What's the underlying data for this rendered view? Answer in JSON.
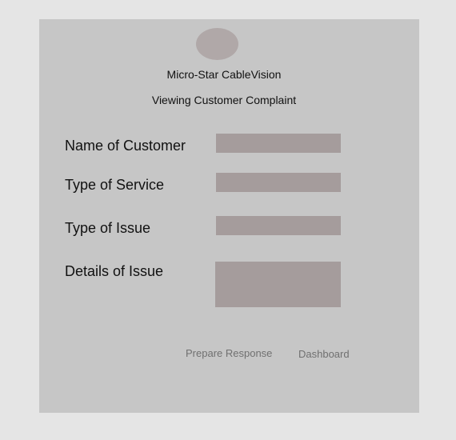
{
  "header": {
    "logo": "logo-circle",
    "company_name": "Micro-Star CableVision",
    "page_title": "Viewing Customer Complaint"
  },
  "form": {
    "fields": [
      {
        "label": "Name of Customer",
        "value": ""
      },
      {
        "label": "Type of Service",
        "value": ""
      },
      {
        "label": "Type of Issue",
        "value": ""
      },
      {
        "label": "Details of Issue",
        "value": ""
      }
    ]
  },
  "actions": {
    "prepare_response_label": "Prepare Response",
    "dashboard_label": "Dashboard"
  },
  "colors": {
    "page_bg": "#e5e5e5",
    "panel_bg": "#c6c6c6",
    "field_bg": "#a59c9c",
    "logo_bg": "#b0a8a8"
  }
}
